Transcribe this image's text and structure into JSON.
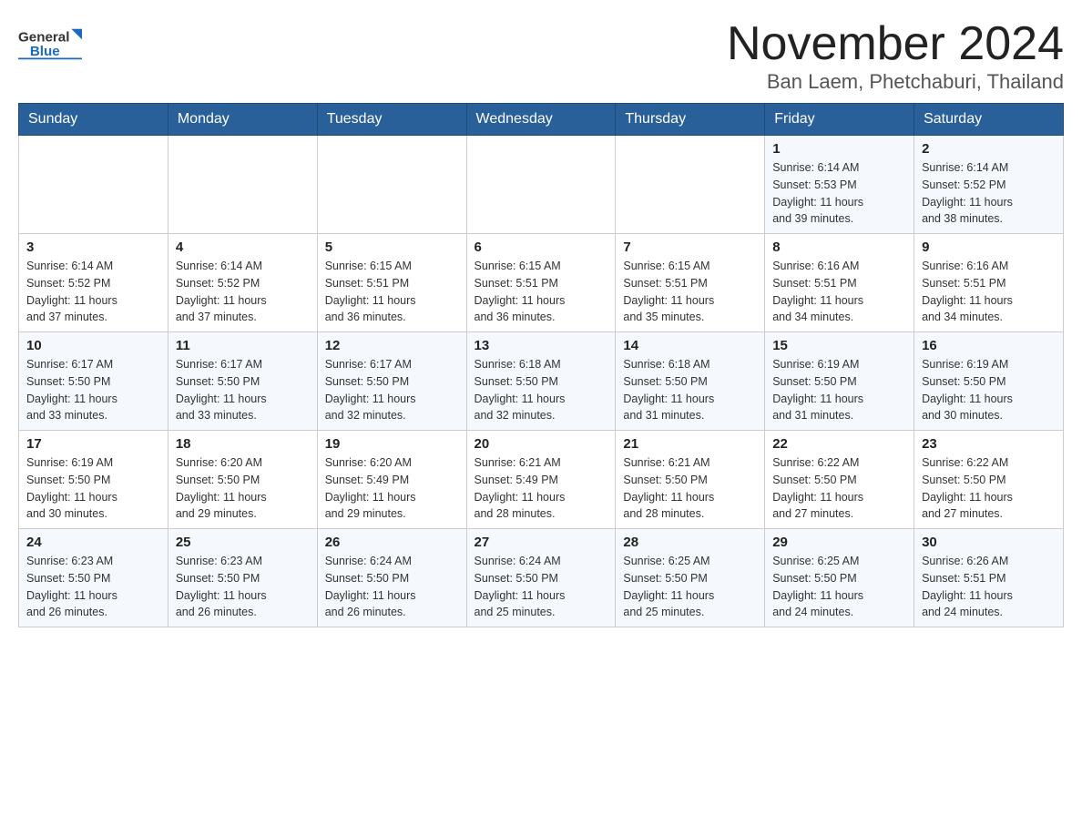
{
  "header": {
    "logo_general": "General",
    "logo_blue": "Blue",
    "title": "November 2024",
    "subtitle": "Ban Laem, Phetchaburi, Thailand"
  },
  "days_of_week": [
    "Sunday",
    "Monday",
    "Tuesday",
    "Wednesday",
    "Thursday",
    "Friday",
    "Saturday"
  ],
  "weeks": [
    [
      {
        "day": "",
        "info": ""
      },
      {
        "day": "",
        "info": ""
      },
      {
        "day": "",
        "info": ""
      },
      {
        "day": "",
        "info": ""
      },
      {
        "day": "",
        "info": ""
      },
      {
        "day": "1",
        "info": "Sunrise: 6:14 AM\nSunset: 5:53 PM\nDaylight: 11 hours\nand 39 minutes."
      },
      {
        "day": "2",
        "info": "Sunrise: 6:14 AM\nSunset: 5:52 PM\nDaylight: 11 hours\nand 38 minutes."
      }
    ],
    [
      {
        "day": "3",
        "info": "Sunrise: 6:14 AM\nSunset: 5:52 PM\nDaylight: 11 hours\nand 37 minutes."
      },
      {
        "day": "4",
        "info": "Sunrise: 6:14 AM\nSunset: 5:52 PM\nDaylight: 11 hours\nand 37 minutes."
      },
      {
        "day": "5",
        "info": "Sunrise: 6:15 AM\nSunset: 5:51 PM\nDaylight: 11 hours\nand 36 minutes."
      },
      {
        "day": "6",
        "info": "Sunrise: 6:15 AM\nSunset: 5:51 PM\nDaylight: 11 hours\nand 36 minutes."
      },
      {
        "day": "7",
        "info": "Sunrise: 6:15 AM\nSunset: 5:51 PM\nDaylight: 11 hours\nand 35 minutes."
      },
      {
        "day": "8",
        "info": "Sunrise: 6:16 AM\nSunset: 5:51 PM\nDaylight: 11 hours\nand 34 minutes."
      },
      {
        "day": "9",
        "info": "Sunrise: 6:16 AM\nSunset: 5:51 PM\nDaylight: 11 hours\nand 34 minutes."
      }
    ],
    [
      {
        "day": "10",
        "info": "Sunrise: 6:17 AM\nSunset: 5:50 PM\nDaylight: 11 hours\nand 33 minutes."
      },
      {
        "day": "11",
        "info": "Sunrise: 6:17 AM\nSunset: 5:50 PM\nDaylight: 11 hours\nand 33 minutes."
      },
      {
        "day": "12",
        "info": "Sunrise: 6:17 AM\nSunset: 5:50 PM\nDaylight: 11 hours\nand 32 minutes."
      },
      {
        "day": "13",
        "info": "Sunrise: 6:18 AM\nSunset: 5:50 PM\nDaylight: 11 hours\nand 32 minutes."
      },
      {
        "day": "14",
        "info": "Sunrise: 6:18 AM\nSunset: 5:50 PM\nDaylight: 11 hours\nand 31 minutes."
      },
      {
        "day": "15",
        "info": "Sunrise: 6:19 AM\nSunset: 5:50 PM\nDaylight: 11 hours\nand 31 minutes."
      },
      {
        "day": "16",
        "info": "Sunrise: 6:19 AM\nSunset: 5:50 PM\nDaylight: 11 hours\nand 30 minutes."
      }
    ],
    [
      {
        "day": "17",
        "info": "Sunrise: 6:19 AM\nSunset: 5:50 PM\nDaylight: 11 hours\nand 30 minutes."
      },
      {
        "day": "18",
        "info": "Sunrise: 6:20 AM\nSunset: 5:50 PM\nDaylight: 11 hours\nand 29 minutes."
      },
      {
        "day": "19",
        "info": "Sunrise: 6:20 AM\nSunset: 5:49 PM\nDaylight: 11 hours\nand 29 minutes."
      },
      {
        "day": "20",
        "info": "Sunrise: 6:21 AM\nSunset: 5:49 PM\nDaylight: 11 hours\nand 28 minutes."
      },
      {
        "day": "21",
        "info": "Sunrise: 6:21 AM\nSunset: 5:50 PM\nDaylight: 11 hours\nand 28 minutes."
      },
      {
        "day": "22",
        "info": "Sunrise: 6:22 AM\nSunset: 5:50 PM\nDaylight: 11 hours\nand 27 minutes."
      },
      {
        "day": "23",
        "info": "Sunrise: 6:22 AM\nSunset: 5:50 PM\nDaylight: 11 hours\nand 27 minutes."
      }
    ],
    [
      {
        "day": "24",
        "info": "Sunrise: 6:23 AM\nSunset: 5:50 PM\nDaylight: 11 hours\nand 26 minutes."
      },
      {
        "day": "25",
        "info": "Sunrise: 6:23 AM\nSunset: 5:50 PM\nDaylight: 11 hours\nand 26 minutes."
      },
      {
        "day": "26",
        "info": "Sunrise: 6:24 AM\nSunset: 5:50 PM\nDaylight: 11 hours\nand 26 minutes."
      },
      {
        "day": "27",
        "info": "Sunrise: 6:24 AM\nSunset: 5:50 PM\nDaylight: 11 hours\nand 25 minutes."
      },
      {
        "day": "28",
        "info": "Sunrise: 6:25 AM\nSunset: 5:50 PM\nDaylight: 11 hours\nand 25 minutes."
      },
      {
        "day": "29",
        "info": "Sunrise: 6:25 AM\nSunset: 5:50 PM\nDaylight: 11 hours\nand 24 minutes."
      },
      {
        "day": "30",
        "info": "Sunrise: 6:26 AM\nSunset: 5:51 PM\nDaylight: 11 hours\nand 24 minutes."
      }
    ]
  ]
}
